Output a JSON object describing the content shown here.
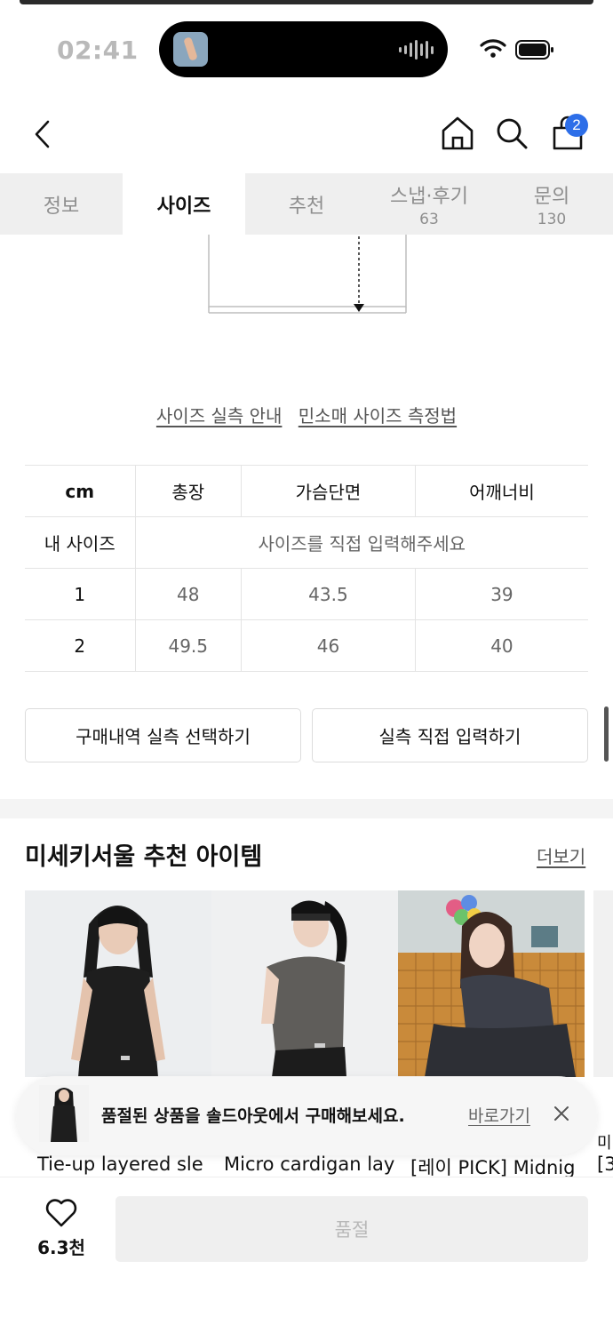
{
  "status_bar": {
    "time": "02:41"
  },
  "header": {
    "cart_count": "2"
  },
  "tabs": [
    {
      "label": "정보",
      "count": ""
    },
    {
      "label": "사이즈",
      "count": ""
    },
    {
      "label": "추천",
      "count": ""
    },
    {
      "label": "스냅·후기",
      "count": "63"
    },
    {
      "label": "문의",
      "count": "130"
    }
  ],
  "active_tab": "사이즈",
  "size_links": {
    "guide": "사이즈 실측 안내",
    "method": "민소매 사이즈 측정법"
  },
  "size_table": {
    "headers": [
      "cm",
      "총장",
      "가슴단면",
      "어깨너비"
    ],
    "my_size": {
      "label": "내 사이즈",
      "placeholder": "사이즈를 직접 입력해주세요"
    },
    "rows": [
      {
        "size": "1",
        "values": [
          "48",
          "43.5",
          "39"
        ]
      },
      {
        "size": "2",
        "values": [
          "49.5",
          "46",
          "40"
        ]
      }
    ]
  },
  "buttons": {
    "select_purchase": "구매내역 실측 선택하기",
    "direct_input": "실측 직접 입력하기"
  },
  "recommend": {
    "title": "미세키서울 추천 아이템",
    "more": "더보기",
    "products": [
      {
        "name": "Tie-up layered sle"
      },
      {
        "name": "Micro cardigan lay"
      },
      {
        "name": "[레이 PICK] Midnig"
      },
      {
        "name": "[3"
      }
    ],
    "partial_label": "미"
  },
  "toast": {
    "message": "품절된 상품을 솔드아웃에서 구매해보세요.",
    "action": "바로가기"
  },
  "bottom_bar": {
    "likes": "6.3천",
    "buy_label": "품절"
  },
  "colors": {
    "badge": "#2d6ee8",
    "tab_bg": "#efefef",
    "soldout_bg": "#efefef"
  }
}
